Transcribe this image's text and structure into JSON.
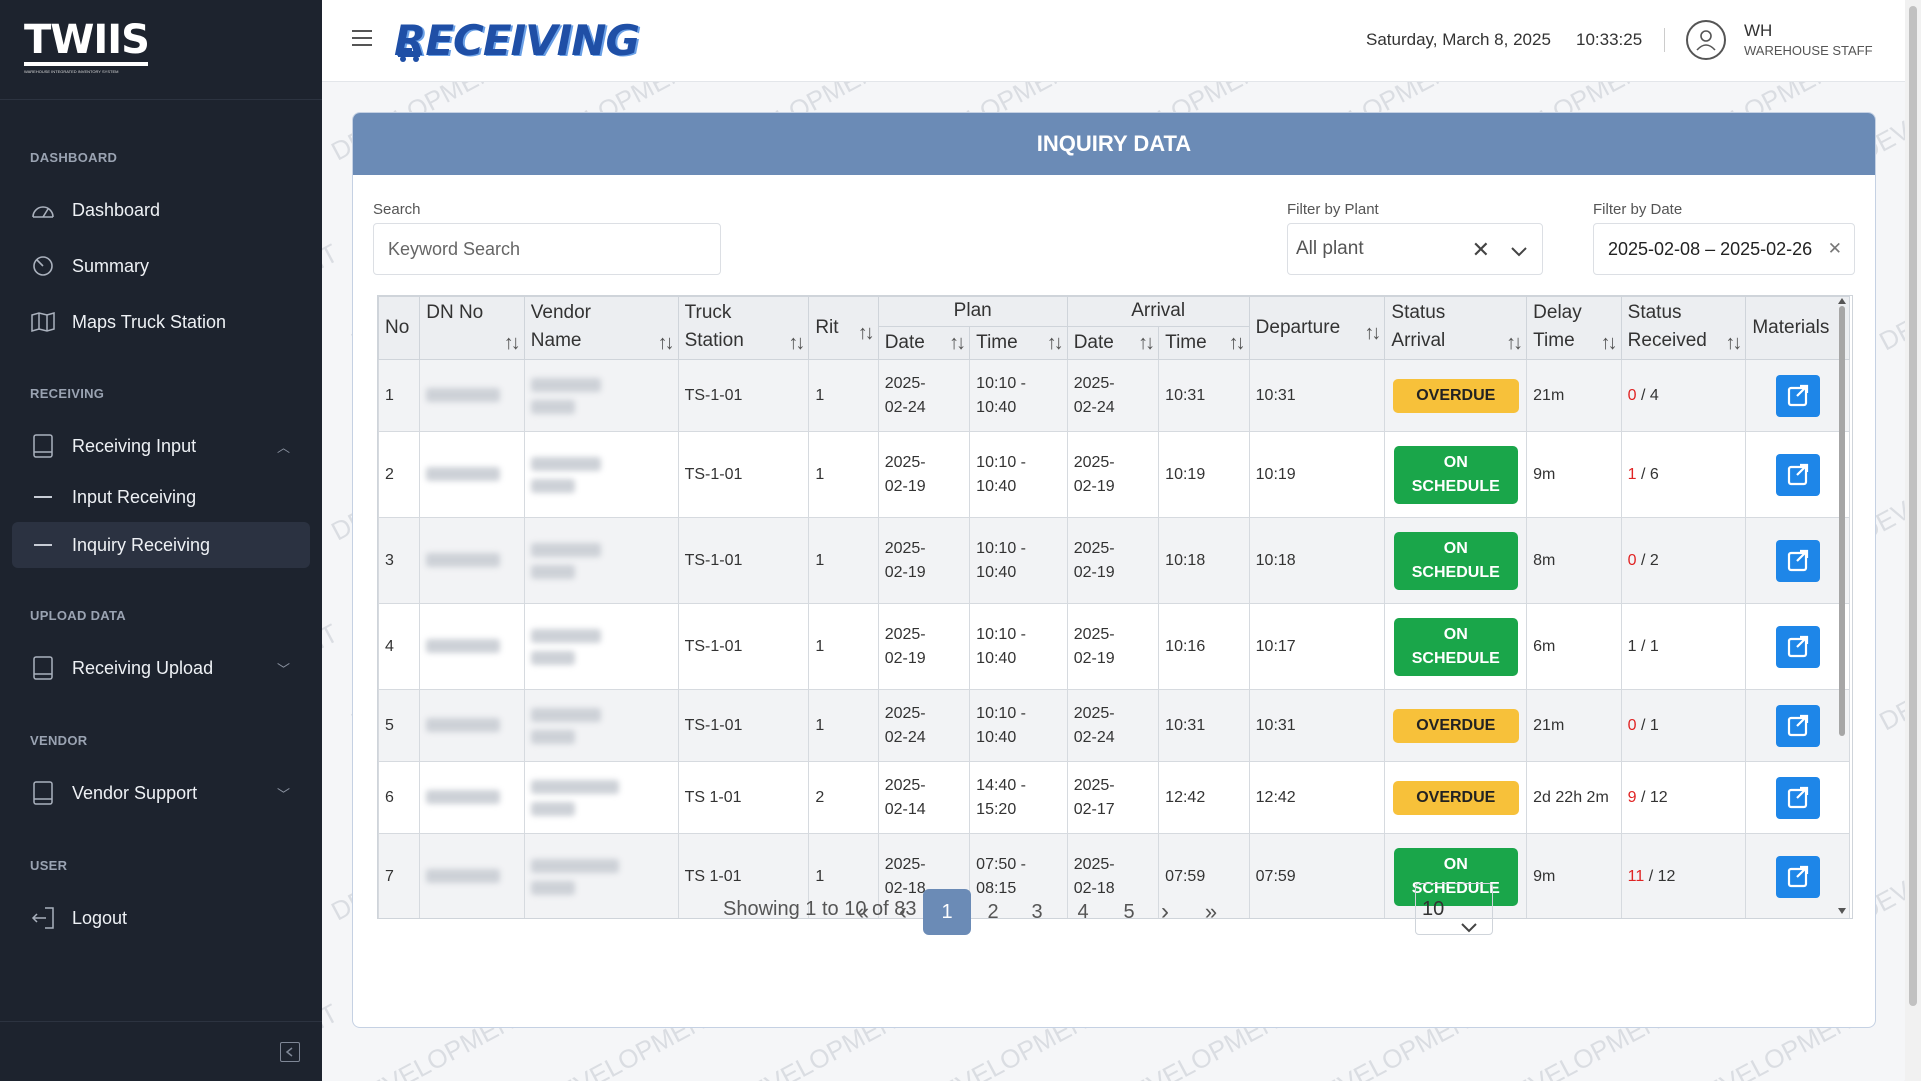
{
  "sidebar": {
    "logo": "TWIIS",
    "logo_sub": "WAREHOUSE INTEGRATED INVENTORY SYSTEM",
    "sections": [
      "DASHBOARD",
      "RECEIVING",
      "UPLOAD DATA",
      "VENDOR",
      "USER"
    ],
    "items": {
      "dashboard": "Dashboard",
      "summary": "Summary",
      "maps": "Maps Truck Station",
      "receiving_input": "Receiving Input",
      "input_receiving": "Input Receiving",
      "inquiry_receiving": "Inquiry Receiving",
      "receiving_upload": "Receiving Upload",
      "vendor_support": "Vendor Support",
      "logout": "Logout"
    }
  },
  "header": {
    "brand": "RECEIVING",
    "date": "Saturday, March 8, 2025",
    "time": "10:33:25",
    "user": "WH",
    "role": "WAREHOUSE STAFF"
  },
  "watermark": "DEVELOPMENT",
  "card": {
    "title": "INQUIRY DATA",
    "search_label": "Search",
    "search_placeholder": "Keyword Search",
    "plant_label": "Filter by Plant",
    "plant_value": "All plant",
    "date_label": "Filter by Date",
    "date_value": "2025-02-08 – 2025-02-26"
  },
  "table": {
    "headers": {
      "no": "No",
      "dn": "DN No",
      "vendor": "Vendor Name",
      "truck": "Truck Station",
      "rit": "Rit",
      "plan": "Plan",
      "arrival": "Arrival",
      "date": "Date",
      "time": "Time",
      "departure": "Departure",
      "status_arrival": "Status Arrival",
      "delay": "Delay Time",
      "status_received": "Status Received",
      "materials": "Materials"
    },
    "rows": [
      {
        "no": "1",
        "station": "TS-1-01",
        "rit": "1",
        "plan_date": "2025-02-24",
        "plan_time": "10:10 - 10:40",
        "arr_date": "2025-02-24",
        "arr_time": "10:31",
        "departure": "10:31",
        "status": "OVERDUE",
        "delay": "21m",
        "recv": "0",
        "total": "4"
      },
      {
        "no": "2",
        "station": "TS-1-01",
        "rit": "1",
        "plan_date": "2025-02-19",
        "plan_time": "10:10 - 10:40",
        "arr_date": "2025-02-19",
        "arr_time": "10:19",
        "departure": "10:19",
        "status": "ON SCHEDULE",
        "delay": "9m",
        "recv": "1",
        "total": "6"
      },
      {
        "no": "3",
        "station": "TS-1-01",
        "rit": "1",
        "plan_date": "2025-02-19",
        "plan_time": "10:10 - 10:40",
        "arr_date": "2025-02-19",
        "arr_time": "10:18",
        "departure": "10:18",
        "status": "ON SCHEDULE",
        "delay": "8m",
        "recv": "0",
        "total": "2"
      },
      {
        "no": "4",
        "station": "TS-1-01",
        "rit": "1",
        "plan_date": "2025-02-19",
        "plan_time": "10:10 - 10:40",
        "arr_date": "2025-02-19",
        "arr_time": "10:16",
        "departure": "10:17",
        "status": "ON SCHEDULE",
        "delay": "6m",
        "recv": "1",
        "total": "1"
      },
      {
        "no": "5",
        "station": "TS-1-01",
        "rit": "1",
        "plan_date": "2025-02-24",
        "plan_time": "10:10 - 10:40",
        "arr_date": "2025-02-24",
        "arr_time": "10:31",
        "departure": "10:31",
        "status": "OVERDUE",
        "delay": "21m",
        "recv": "0",
        "total": "1"
      },
      {
        "no": "6",
        "station": "TS 1-01",
        "rit": "2",
        "plan_date": "2025-02-14",
        "plan_time": "14:40 - 15:20",
        "arr_date": "2025-02-17",
        "arr_time": "12:42",
        "departure": "12:42",
        "status": "OVERDUE",
        "delay": "2d 22h 2m",
        "recv": "9",
        "total": "12"
      },
      {
        "no": "7",
        "station": "TS 1-01",
        "rit": "1",
        "plan_date": "2025-02-18",
        "plan_time": "07:50 - 08:15",
        "arr_date": "2025-02-18",
        "arr_time": "07:59",
        "departure": "07:59",
        "status": "ON SCHEDULE",
        "delay": "9m",
        "recv": "11",
        "total": "12"
      }
    ]
  },
  "pagination": {
    "summary": "Showing 1 to 10 of 83",
    "pages": [
      "1",
      "2",
      "3",
      "4",
      "5"
    ],
    "current": "1",
    "first": "«",
    "prev": "‹",
    "next": "›",
    "last": "»",
    "page_size": "10"
  },
  "colors": {
    "sidebar": "#1d232e",
    "header_bar": "#6b8bb6",
    "overdue": "#f7c13a",
    "on_schedule": "#1aa64a",
    "action": "#1e86e8"
  }
}
